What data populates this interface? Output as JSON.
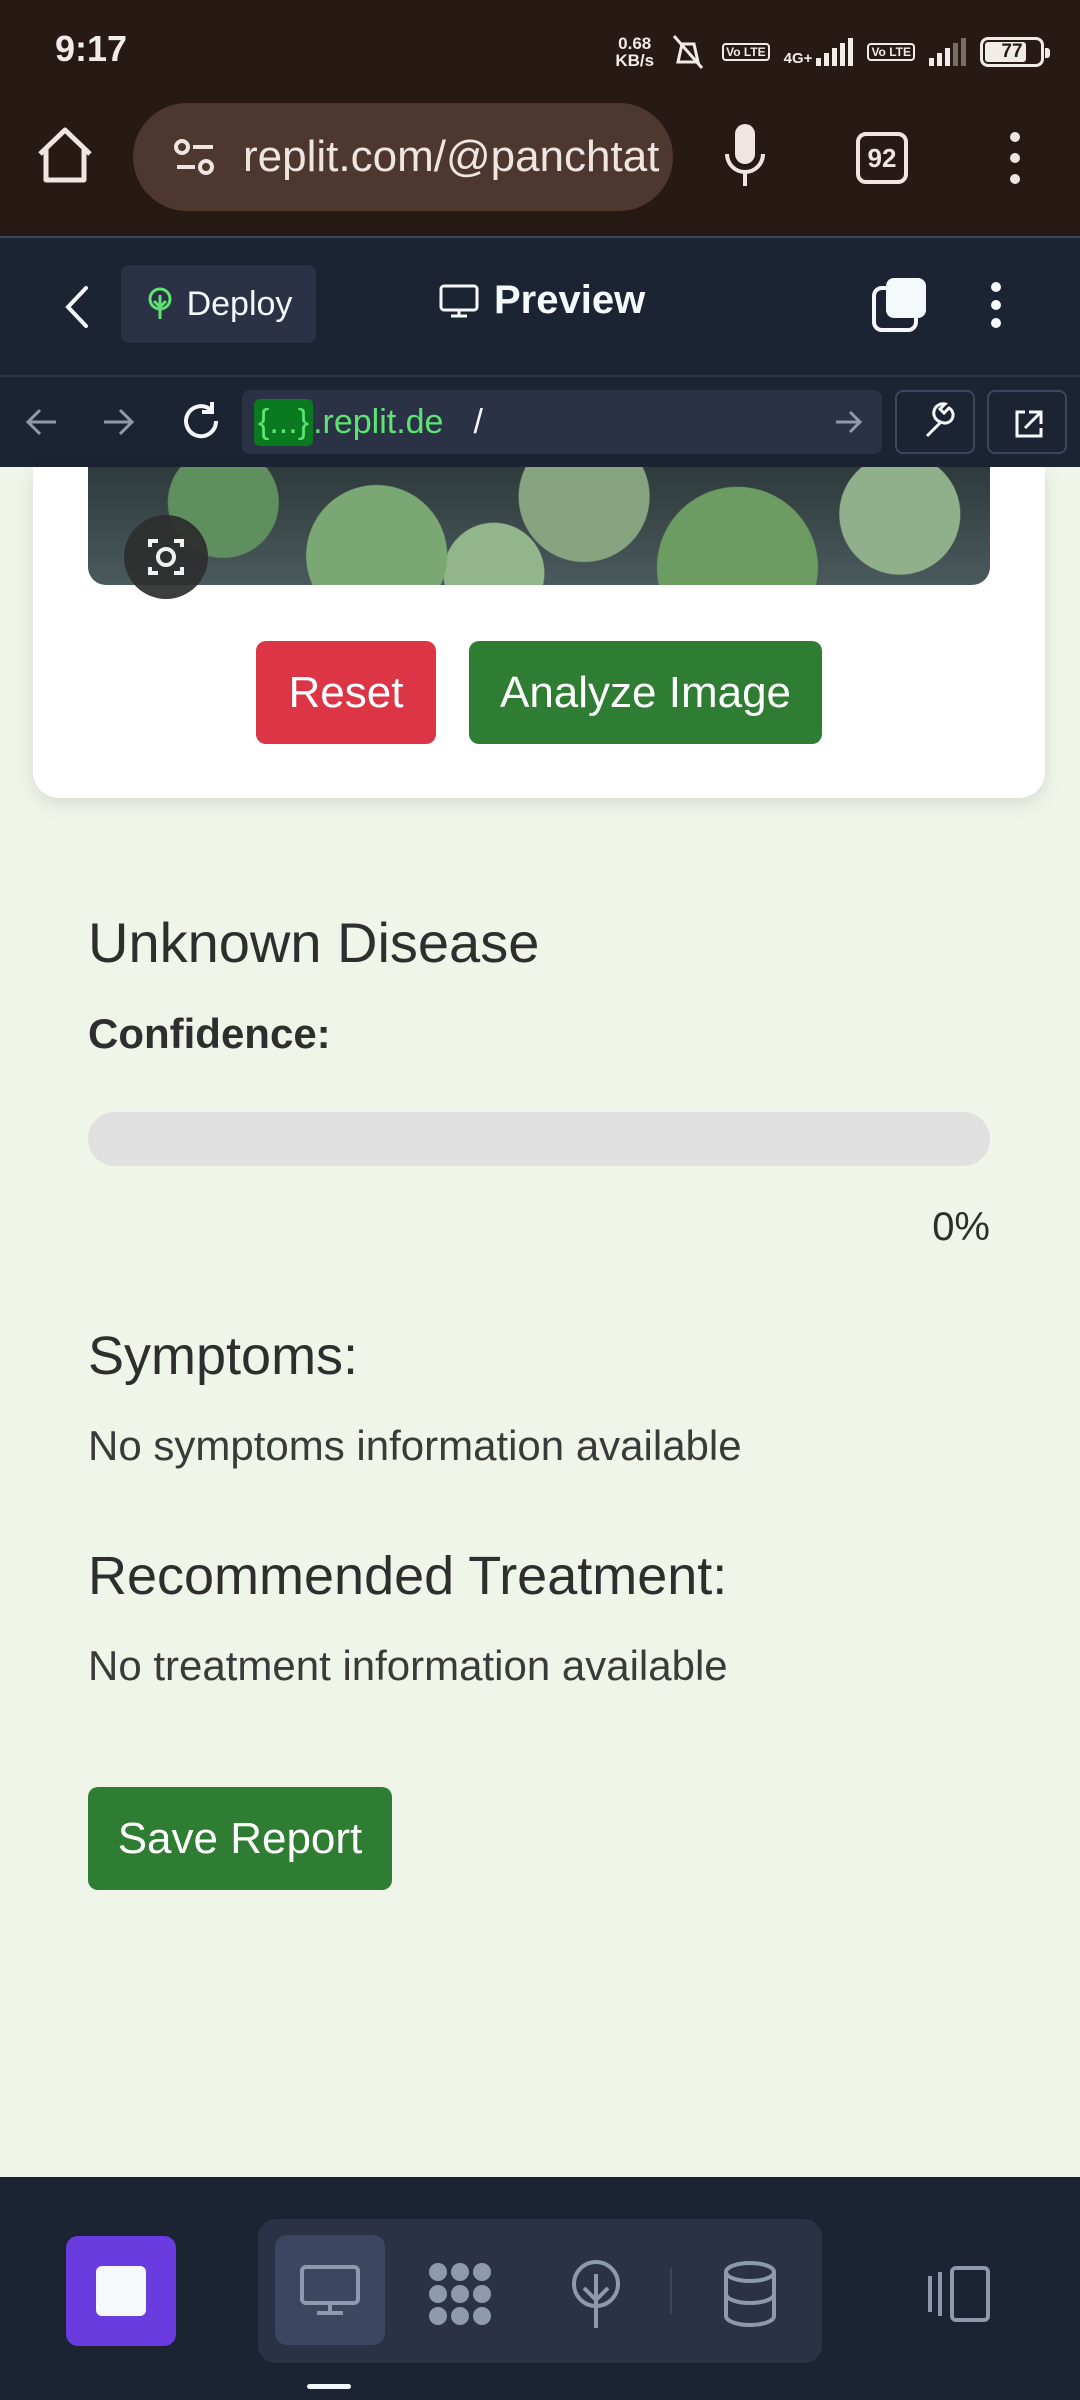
{
  "status_bar": {
    "time": "9:17",
    "net_speed_value": "0.68",
    "net_speed_unit": "KB/s",
    "lte1": "Vo LTE",
    "lte2": "Vo LTE",
    "network_type": "4G+",
    "battery": "77",
    "battery_level": 0.77
  },
  "browser": {
    "url": "replit.com/@panchtat",
    "tab_count": "92"
  },
  "replit_header": {
    "deploy_label": "Deploy",
    "preview_label": "Preview"
  },
  "devbar": {
    "url_badge": "{...}",
    "url_host": ".replit.de",
    "url_path": "/"
  },
  "app": {
    "reset_label": "Reset",
    "analyze_label": "Analyze Image",
    "disease_title": "Unknown Disease",
    "confidence_label": "Confidence:",
    "confidence_value": "0%",
    "confidence_fraction": 0,
    "symptoms_title": "Symptoms:",
    "symptoms_text": "No symptoms information available",
    "treatment_title": "Recommended Treatment:",
    "treatment_text": "No treatment information available",
    "save_label": "Save Report"
  },
  "icons": {
    "home": "home-icon",
    "site_info": "tune-icon",
    "mic": "mic-icon",
    "menu": "more-vert-icon",
    "deploy": "deploy-tree-icon",
    "preview": "monitor-icon",
    "bottom_tools": [
      "monitor-icon",
      "extensions-icon",
      "deploy-icon",
      "database-icon",
      "panes-icon"
    ]
  },
  "colors": {
    "browser_bg": "#271913",
    "replit_bg": "#1c2333",
    "page_bg": "#eff5e9",
    "primary_green": "#2e7d32",
    "danger_red": "#dc3545",
    "stop_purple": "#6a3ce0"
  }
}
